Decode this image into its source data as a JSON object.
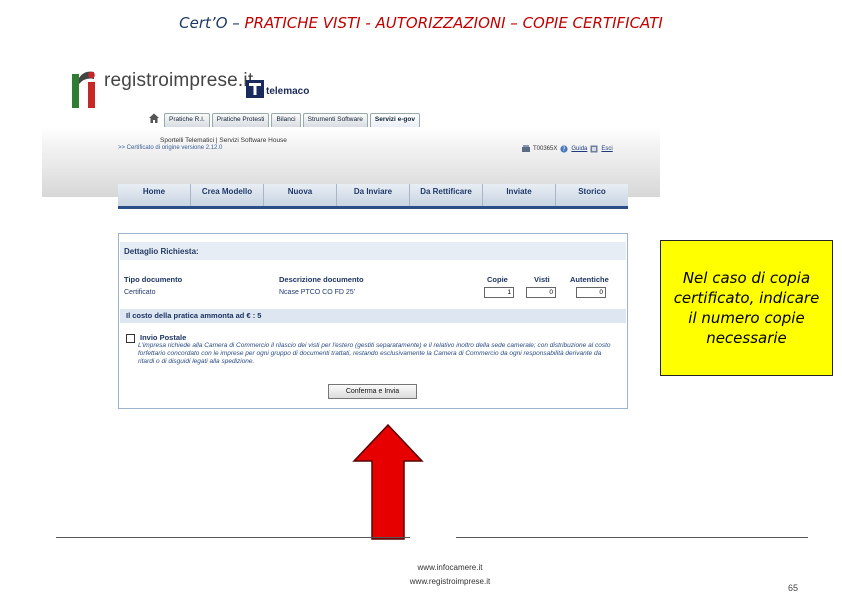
{
  "slide": {
    "title_lead": "Cert’O – ",
    "title_rest": "PRATICHE VISTI  - AUTORIZZAZIONI – COPIE CERTIFICATI"
  },
  "header": {
    "logo_text": "registroimprese.it",
    "telemaco_text": "telemaco",
    "tabs": [
      "Pratiche R.I.",
      "Pratiche Protesti",
      "Bilanci",
      "Strumenti Software",
      "Servizi e-gov"
    ],
    "active_tab": 4,
    "sub_line1": "Sportelli Telematici  |  Servizi Software House",
    "sub_line2": ">> Certificato di origine versione 2.12.0",
    "user_id": "T00365X",
    "guide_label": "Guida",
    "exit_label": "Esci"
  },
  "nav": {
    "items": [
      "Home",
      "Crea Modello",
      "Nuova",
      "Da Inviare",
      "Da Rettificare",
      "Inviate",
      "Storico"
    ]
  },
  "panel": {
    "title": "Dettaglio Richiesta:",
    "columns": {
      "tipo": "Tipo documento",
      "descrizione": "Descrizione documento",
      "copie": "Copie",
      "visti": "Visti",
      "autentiche": "Autentiche"
    },
    "row": {
      "tipo": "Certificato",
      "descrizione": "Ncase  PTCO  CO  FD  25'",
      "copie": "1",
      "visti": "0",
      "autentiche": "0"
    },
    "cost_label": "Il costo della pratica ammonta ad € : 5",
    "invio_label": "Invio Postale",
    "invio_text": "L'impresa richiede alla Camera di Commercio il rilascio dei visti per l'estero (gestiti separatamente) e il relativo inoltro della sede camerale; con distribuzione al costo forfettario concordato con le imprese per ogni gruppo di documenti trattati, restando esclusivamente la Camera di Commercio da ogni responsabilità derivante da ritardi o di disguidi legati alla spedizione.",
    "confirm_label": "Conferma e Invia"
  },
  "callout": {
    "text": "Nel caso di copia certificato, indicare il numero copie necessarie"
  },
  "footer": {
    "url1": "www.infocamere.it",
    "url2": "www.registroimprese.it",
    "page": "65"
  },
  "colors": {
    "title_red": "#c00000",
    "title_blue": "#1f3864",
    "callout_bg": "#ffff00",
    "arrow_red": "#e60000",
    "nav_border": "#2a4f88"
  }
}
